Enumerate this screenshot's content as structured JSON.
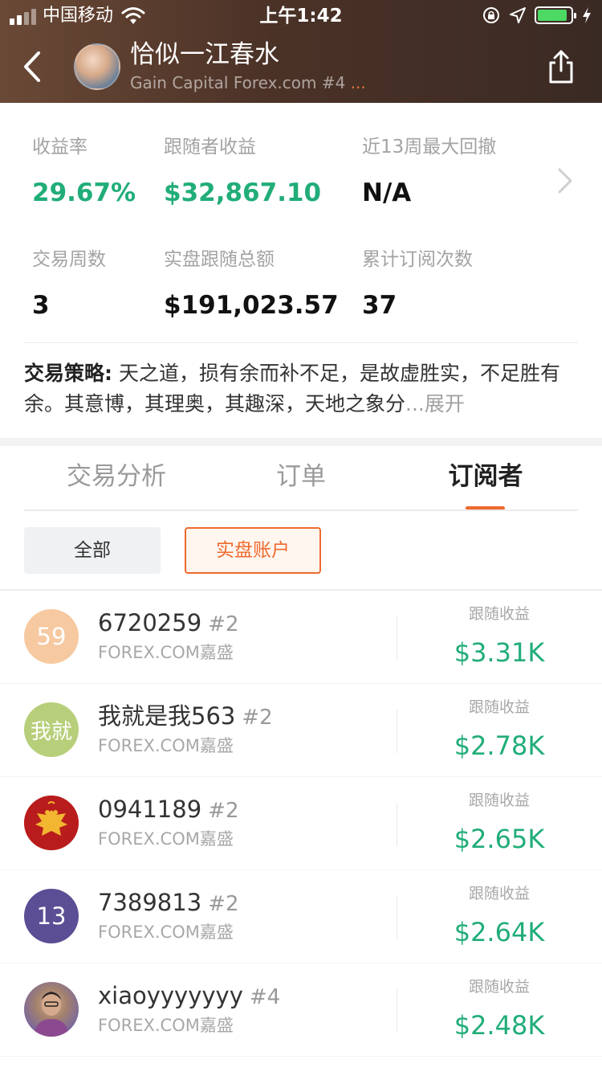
{
  "status_bar": {
    "carrier": "中国移动",
    "time": "上午1:42",
    "battery_level": 0.9
  },
  "nav": {
    "title": "恰似一江春水",
    "subtitle": "Gain Capital Forex.com #4",
    "subtitle_ellipsis": " ..."
  },
  "stats": {
    "return_rate": {
      "label": "收益率",
      "value": "29.67%"
    },
    "follower_profit": {
      "label": "跟随者收益",
      "value": "$32,867.10"
    },
    "max_drawdown": {
      "label": "近13周最大回撤",
      "value": "N/A"
    },
    "trading_weeks": {
      "label": "交易周数",
      "value": "3"
    },
    "real_follow_total": {
      "label": "实盘跟随总额",
      "value": "$191,023.57"
    },
    "subscription_count": {
      "label": "累计订阅次数",
      "value": "37"
    }
  },
  "strategy": {
    "label": "交易策略:",
    "text": " 天之道，损有余而补不足，是故虚胜实，不足胜有余。其意博，其理奥，其趣深，天地之象分",
    "more": "...展开"
  },
  "tabs": [
    "交易分析",
    "订单",
    "订阅者"
  ],
  "active_tab": "订阅者",
  "filters": {
    "all": "全部",
    "real_account": "实盘账户"
  },
  "colors": {
    "green": "#21ad78",
    "orange": "#ee6a2e"
  },
  "subscribers": [
    {
      "avatar_text": "59",
      "avatar_color": "#f7c9a0",
      "name": "6720259",
      "rank": "#2",
      "broker": "FOREX.COM嘉盛",
      "gain_label": "跟随收益",
      "gain": "$3.31K"
    },
    {
      "avatar_text": "我就",
      "avatar_color": "#b7cf7a",
      "name": "我就是我563",
      "rank": "#2",
      "broker": "FOREX.COM嘉盛",
      "gain_label": "跟随收益",
      "gain": "$2.78K"
    },
    {
      "avatar_text": "",
      "avatar_color": "#b91c1c",
      "name": "0941189",
      "rank": "#2",
      "broker": "FOREX.COM嘉盛",
      "gain_label": "跟随收益",
      "gain": "$2.65K"
    },
    {
      "avatar_text": "13",
      "avatar_color": "#5b4e94",
      "name": "7389813",
      "rank": "#2",
      "broker": "FOREX.COM嘉盛",
      "gain_label": "跟随收益",
      "gain": "$2.64K"
    },
    {
      "avatar_text": "",
      "avatar_color": "#8a6b8f",
      "name": "xiaoyyyyyyy",
      "rank": "#4",
      "broker": "FOREX.COM嘉盛",
      "gain_label": "跟随收益",
      "gain": "$2.48K"
    }
  ]
}
